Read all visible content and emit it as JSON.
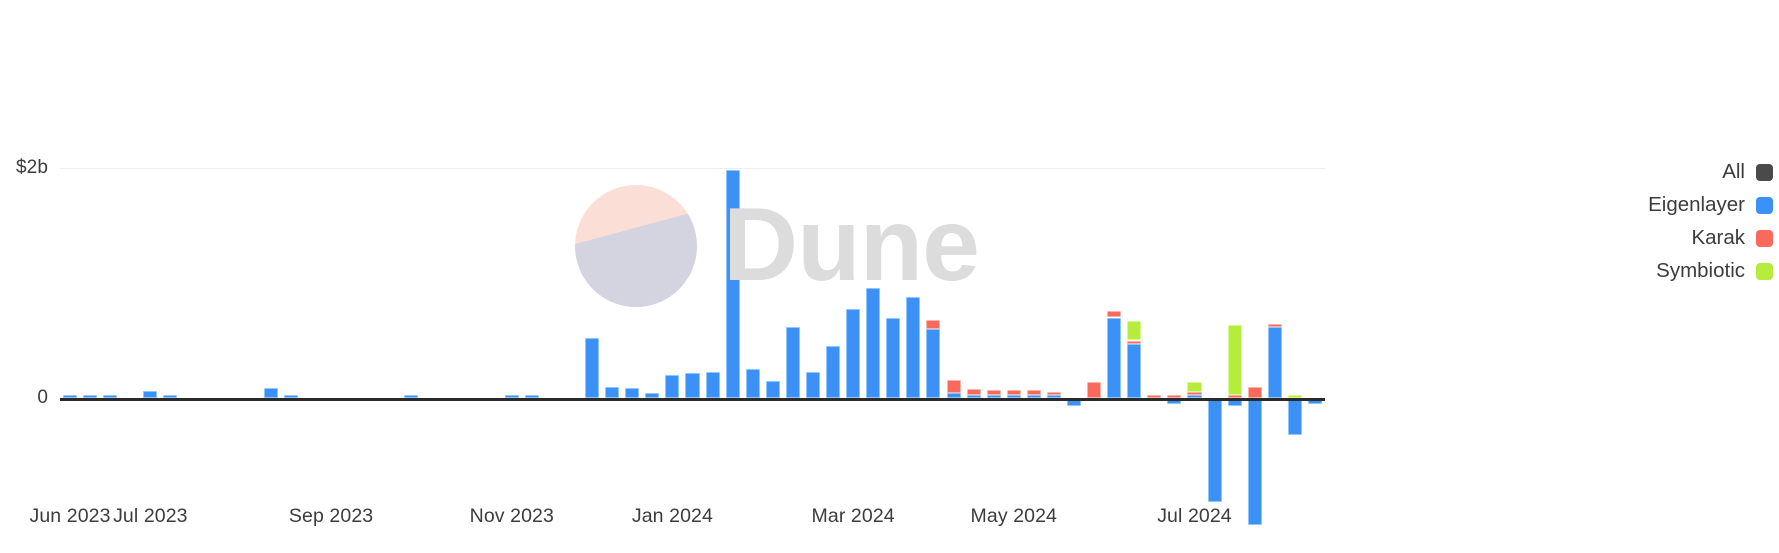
{
  "chart_data": {
    "type": "bar",
    "title": "",
    "subtitle": "",
    "xlabel": "",
    "ylabel": "",
    "stacked": true,
    "grid": true,
    "legend_position": "right",
    "ylim": [
      -1.25,
      4.0
    ],
    "yticks": [
      {
        "value": 2000000000,
        "label": "$2b"
      },
      {
        "value": 0,
        "label": "0"
      }
    ],
    "xticks": [
      {
        "index": 0,
        "label": "Jun 2023"
      },
      {
        "index": 4,
        "label": "Jul 2023"
      },
      {
        "index": 13,
        "label": "Sep 2023"
      },
      {
        "index": 22,
        "label": "Nov 2023"
      },
      {
        "index": 30,
        "label": "Jan 2024"
      },
      {
        "index": 39,
        "label": "Mar 2024"
      },
      {
        "index": 47,
        "label": "May 2024"
      },
      {
        "index": 56,
        "label": "Jul 2024"
      }
    ],
    "x": [
      "2023-06-05",
      "2023-06-12",
      "2023-06-19",
      "2023-06-26",
      "2023-07-03",
      "2023-07-10",
      "2023-07-17",
      "2023-07-24",
      "2023-07-31",
      "2023-08-07",
      "2023-08-14",
      "2023-08-21",
      "2023-08-28",
      "2023-09-04",
      "2023-09-11",
      "2023-09-18",
      "2023-09-25",
      "2023-10-02",
      "2023-10-09",
      "2023-10-16",
      "2023-10-23",
      "2023-10-30",
      "2023-11-06",
      "2023-11-13",
      "2023-11-20",
      "2023-11-27",
      "2023-12-04",
      "2023-12-11",
      "2023-12-18",
      "2023-12-25",
      "2024-01-01",
      "2024-01-08",
      "2024-01-15",
      "2024-01-22",
      "2024-01-29",
      "2024-02-05",
      "2024-02-12",
      "2024-02-19",
      "2024-02-26",
      "2024-03-04",
      "2024-03-11",
      "2024-03-18",
      "2024-03-25",
      "2024-04-01",
      "2024-04-08",
      "2024-04-15",
      "2024-04-22",
      "2024-04-29",
      "2024-05-06",
      "2024-05-13",
      "2024-05-20",
      "2024-05-27",
      "2024-06-03",
      "2024-06-10",
      "2024-06-17",
      "2024-06-24",
      "2024-07-01",
      "2024-07-08",
      "2024-07-15",
      "2024-07-22",
      "2024-07-29",
      "2024-08-05",
      "2024-08-12"
    ],
    "series": [
      {
        "name": "Eigenlayer",
        "color": "#3b91f5",
        "values": [
          0.01,
          0.02,
          0.01,
          0.0,
          0.06,
          0.01,
          0.0,
          0.0,
          0.0,
          0.0,
          0.09,
          0.02,
          0.0,
          0.0,
          0.0,
          0.0,
          0.0,
          0.01,
          0.0,
          0.0,
          0.0,
          0.0,
          0.01,
          0.02,
          0.0,
          0.0,
          0.52,
          0.1,
          0.09,
          0.04,
          0.2,
          0.22,
          0.23,
          1.98,
          0.25,
          0.15,
          0.62,
          0.23,
          0.45,
          0.77,
          0.96,
          0.7,
          0.88,
          0.6,
          0.04,
          0.02,
          0.01,
          0.01,
          0.02,
          0.02,
          -0.07,
          0.0,
          0.7,
          0.47,
          0.0,
          -0.05,
          0.02,
          -0.9,
          -0.07,
          -1.1,
          0.62,
          -0.32,
          -0.05
        ]
      },
      {
        "name": "Karak",
        "color": "#f96a5c",
        "values": [
          0,
          0,
          0,
          0,
          0,
          0,
          0,
          0,
          0,
          0,
          0,
          0,
          0,
          0,
          0,
          0,
          0,
          0,
          0,
          0,
          0,
          0,
          0,
          0,
          0,
          0,
          0,
          0,
          0,
          0,
          0,
          0,
          0,
          0,
          0,
          0,
          0,
          0,
          0,
          0,
          0,
          0,
          0,
          0.08,
          0.12,
          0.05,
          0.04,
          0.04,
          0.04,
          0.03,
          0.0,
          0.14,
          0.06,
          0.03,
          0.03,
          0.02,
          0.02,
          0.0,
          0.01,
          0.1,
          0.01,
          0.0,
          0.0
        ]
      },
      {
        "name": "Symbiotic",
        "color": "#b6ed3d",
        "values": [
          0,
          0,
          0,
          0,
          0,
          0,
          0,
          0,
          0,
          0,
          0,
          0,
          0,
          0,
          0,
          0,
          0,
          0,
          0,
          0,
          0,
          0,
          0,
          0,
          0,
          0,
          0,
          0,
          0,
          0,
          0,
          0,
          0,
          0,
          0,
          0,
          0,
          0,
          0,
          0,
          0,
          0,
          0,
          0,
          0,
          0,
          0,
          0,
          0,
          0,
          0,
          0,
          0,
          0.17,
          0.0,
          0.0,
          0.09,
          0.0,
          0.61,
          0.0,
          0.0,
          0.02,
          0.0
        ]
      }
    ]
  },
  "legend": {
    "items": [
      {
        "label": "All",
        "color": "#4a4a4a"
      },
      {
        "label": "Eigenlayer",
        "color": "#3b91f5"
      },
      {
        "label": "Karak",
        "color": "#f96a5c"
      },
      {
        "label": "Symbiotic",
        "color": "#b6ed3d"
      }
    ]
  },
  "watermark": {
    "text": "Dune",
    "logo_top_color": "#fbdfd6",
    "logo_bottom_color": "#d3d4e0"
  }
}
